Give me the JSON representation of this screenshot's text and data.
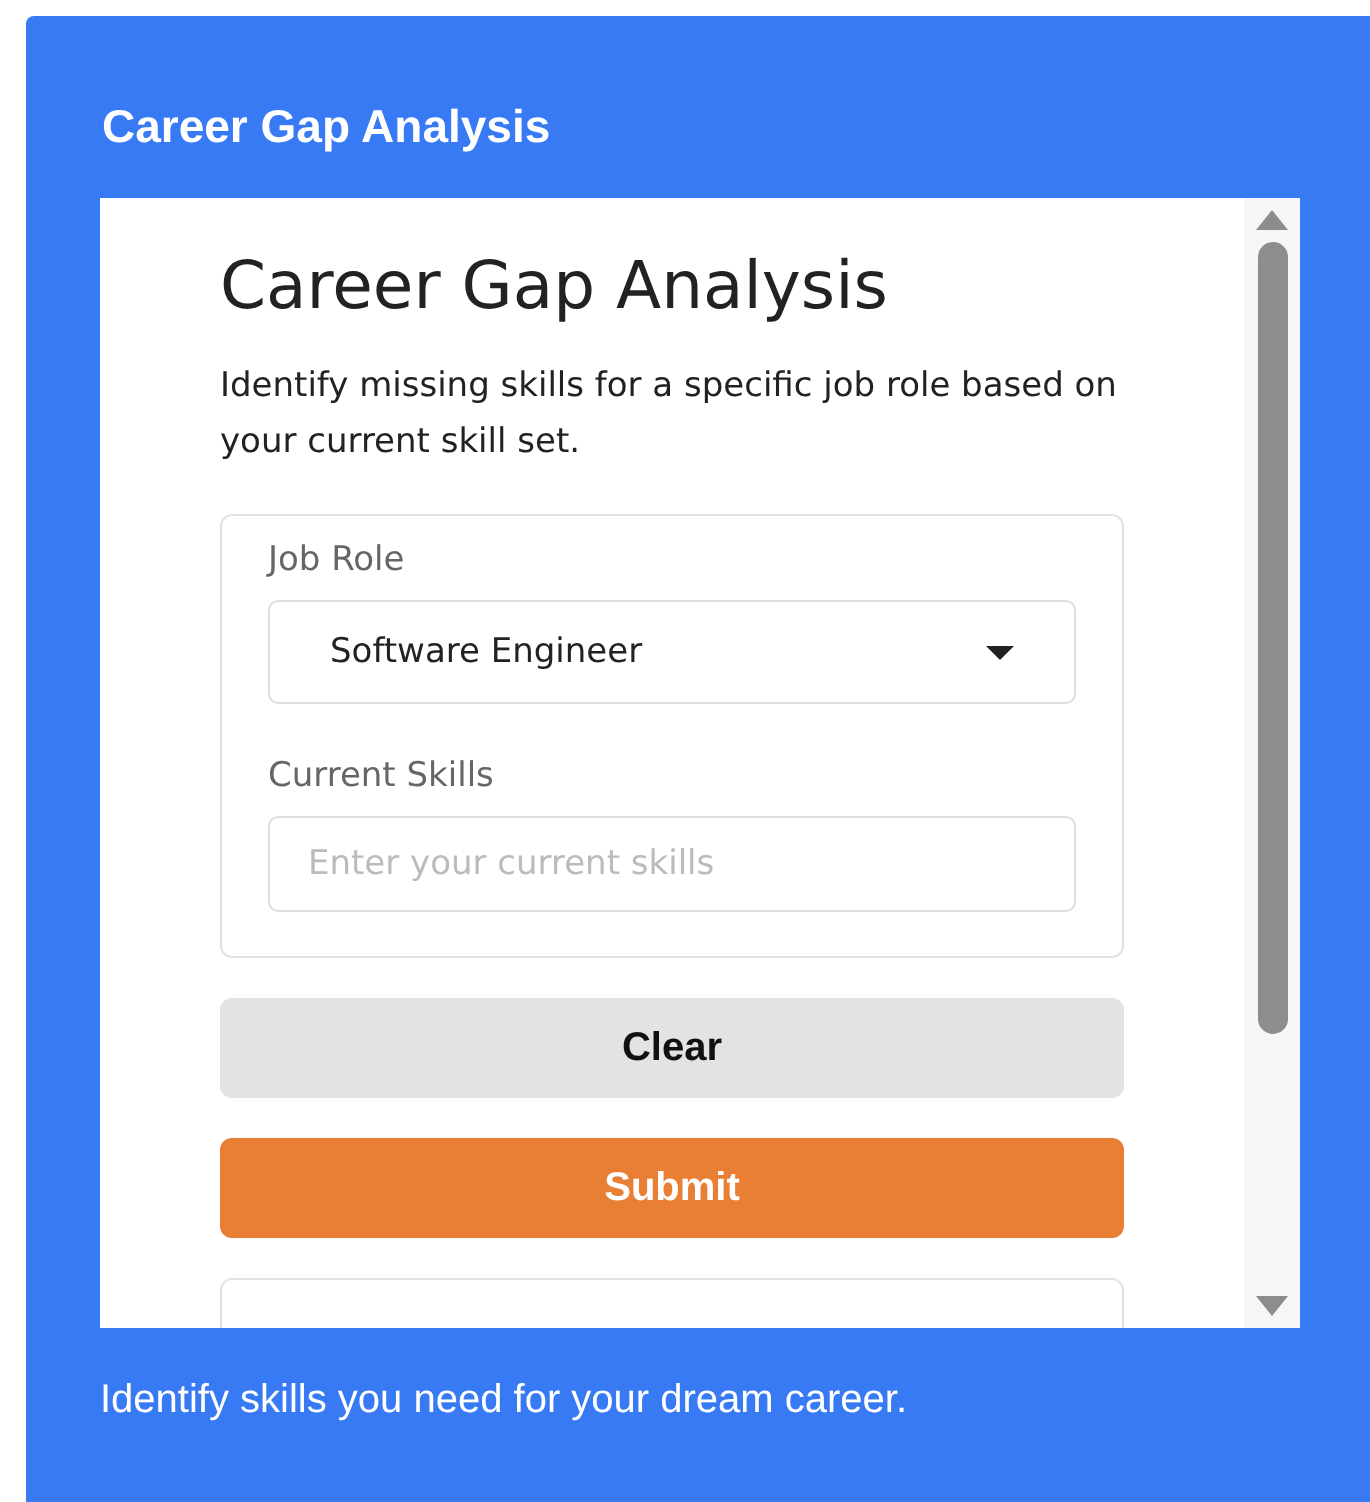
{
  "panel": {
    "title": "Career Gap Analysis",
    "footer": "Identify skills you need for your dream career."
  },
  "form": {
    "heading": "Career Gap Analysis",
    "description": "Identify missing skills for a specific job role based on your current skill set.",
    "job_role": {
      "label": "Job Role",
      "value": "Software Engineer"
    },
    "current_skills": {
      "label": "Current Skills",
      "placeholder": "Enter your current skills"
    },
    "buttons": [
      {
        "label": "Clear",
        "kind": "secondary"
      },
      {
        "label": "Submit",
        "kind": "primary"
      }
    ]
  }
}
